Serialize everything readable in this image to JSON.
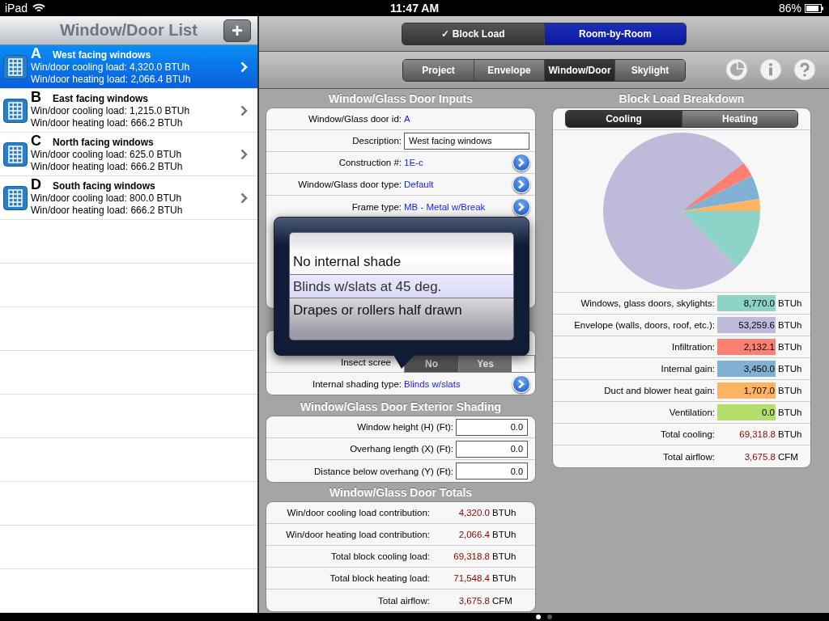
{
  "status_bar": {
    "device": "iPad",
    "time": "11:47 AM",
    "battery": "86%"
  },
  "list": {
    "title": "Window/Door List",
    "add_button": "+",
    "items": [
      {
        "letter": "A",
        "title": "West facing windows",
        "cooling": "Win/door cooling load: 4,320.0 BTUh",
        "heating": "Win/door heating load: 2,066.4 BTUh",
        "selected": true
      },
      {
        "letter": "B",
        "title": "East facing windows",
        "cooling": "Win/door cooling load: 1,215.0 BTUh",
        "heating": "Win/door heating load: 666.2 BTUh",
        "selected": false
      },
      {
        "letter": "C",
        "title": "North facing windows",
        "cooling": "Win/door cooling load: 625.0 BTUh",
        "heating": "Win/door heating load: 666.2 BTUh",
        "selected": false
      },
      {
        "letter": "D",
        "title": "South facing windows",
        "cooling": "Win/door cooling load: 800.0 BTUh",
        "heating": "Win/door heating load: 666.2 BTUh",
        "selected": false
      }
    ]
  },
  "mode_tabs": [
    {
      "label": "✓ Block Load",
      "selected": false
    },
    {
      "label": "Room-by-Room",
      "selected": true
    }
  ],
  "section_tabs": [
    {
      "label": "Project",
      "selected": false
    },
    {
      "label": "Envelope",
      "selected": false
    },
    {
      "label": "Window/Door",
      "selected": true
    },
    {
      "label": "Skylight",
      "selected": false
    }
  ],
  "inputs": {
    "title": "Window/Glass Door Inputs",
    "rows": [
      {
        "kind": "value",
        "label": "Window/Glass door id:",
        "value": "A"
      },
      {
        "kind": "field",
        "label": "Description:",
        "value": "West facing windows"
      },
      {
        "kind": "select",
        "label": "Construction #:",
        "value": "1E-c"
      },
      {
        "kind": "select",
        "label": "Window/Glass door type:",
        "value": "Default"
      },
      {
        "kind": "select",
        "label": "Frame type:",
        "value": "MB - Metal w/Break"
      }
    ]
  },
  "interior": {
    "rows": [
      {
        "kind": "toggle",
        "label": "Insect scree",
        "options": [
          {
            "label": "No",
            "selected": true
          },
          {
            "label": "Yes",
            "selected": false
          }
        ]
      },
      {
        "kind": "select",
        "label": "Internal shading type:",
        "value": "Blinds w/slats"
      }
    ]
  },
  "picker": {
    "options": [
      {
        "label": "No internal shade",
        "selected": false
      },
      {
        "label": "Blinds w/slats at 45 deg.",
        "selected": true
      },
      {
        "label": "Drapes or rollers half drawn",
        "selected": false
      }
    ]
  },
  "exterior": {
    "title": "Window/Glass Door Exterior Shading",
    "rows": [
      {
        "label": "Window height (H) (Ft):",
        "value": "0.0"
      },
      {
        "label": "Overhang length (X) (Ft):",
        "value": "0.0"
      },
      {
        "label": "Distance below overhang (Y) (Ft):",
        "value": "0.0"
      }
    ]
  },
  "totals": {
    "title": "Window/Glass Door Totals",
    "rows": [
      {
        "label": "Win/door cooling load contribution:",
        "value": "4,320.0",
        "unit": "BTUh"
      },
      {
        "label": "Win/door heating load contribution:",
        "value": "2,066.4",
        "unit": "BTUh"
      },
      {
        "label": "Total block cooling load:",
        "value": "69,318.8",
        "unit": "BTUh"
      },
      {
        "label": "Total block heating load:",
        "value": "71,548.4",
        "unit": "BTUh"
      },
      {
        "label": "Total airflow:",
        "value": "3,675.8",
        "unit": "CFM"
      }
    ]
  },
  "breakdown": {
    "title": "Block Load Breakdown",
    "tabs": [
      {
        "label": "Cooling",
        "selected": true
      },
      {
        "label": "Heating",
        "selected": false
      }
    ],
    "chart_data": {
      "type": "pie",
      "values": [
        12.65,
        76.83,
        3.08,
        4.98,
        2.46,
        0.0
      ]
    },
    "legend": [
      {
        "label": "Windows, glass doors, skylights:",
        "value": "8,770.0",
        "unit": "BTUh",
        "color": "#8dd3c7"
      },
      {
        "label": "Envelope (walls, doors, roof, etc.):",
        "value": "53,259.6",
        "unit": "BTUh",
        "color": "#bebada"
      },
      {
        "label": "Infiltration:",
        "value": "2,132.1",
        "unit": "BTUh",
        "color": "#fb8072"
      },
      {
        "label": "Internal gain:",
        "value": "3,450.0",
        "unit": "BTUh",
        "color": "#80b1d3"
      },
      {
        "label": "Duct and blower heat gain:",
        "value": "1,707.0",
        "unit": "BTUh",
        "color": "#fdb462"
      },
      {
        "label": "Ventilation:",
        "value": "0.0",
        "unit": "BTUh",
        "color": "#b3de69"
      }
    ],
    "rows": [
      {
        "label": "Total cooling:",
        "value": "69,318.8",
        "unit": "BTUh"
      },
      {
        "label": "Total airflow:",
        "value": "3,675.8",
        "unit": "CFM"
      }
    ]
  },
  "pages": [
    {
      "selected": true
    },
    {
      "selected": false
    }
  ]
}
